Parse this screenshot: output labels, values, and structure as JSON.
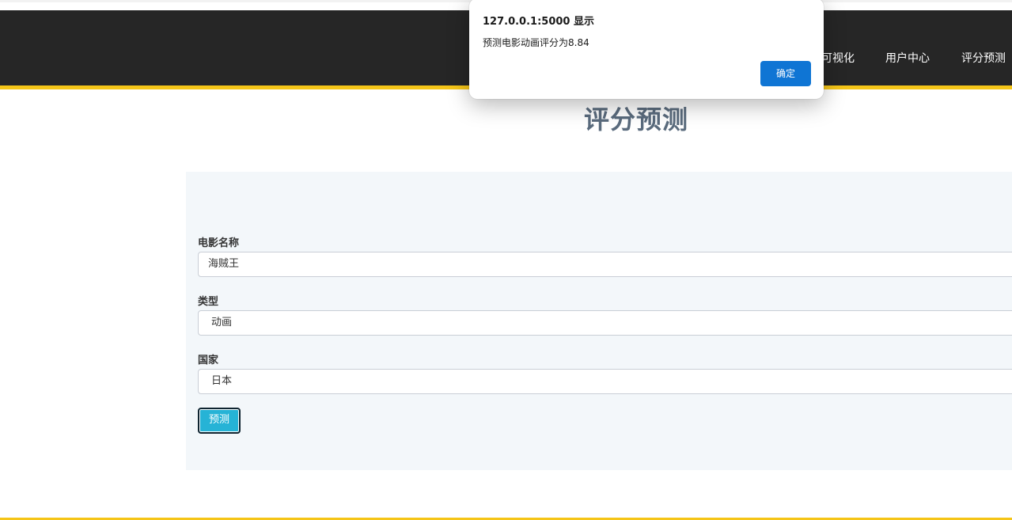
{
  "nav": {
    "links": [
      {
        "label": "可视化"
      },
      {
        "label": "用户中心"
      },
      {
        "label": "评分预测"
      }
    ]
  },
  "page": {
    "title": "评分预测"
  },
  "form": {
    "name_label": "电影名称",
    "name_value": "海贼王",
    "type_label": "类型",
    "type_value": "动画",
    "country_label": "国家",
    "country_value": "日本",
    "submit_label": "预测"
  },
  "alert": {
    "title": "127.0.0.1:5000 显示",
    "message": "预测电影动画评分为8.84",
    "ok_label": "确定"
  },
  "colors": {
    "navbar_bg": "#262626",
    "accent_yellow": "#f5c518",
    "panel_bg": "#f3f7fa",
    "button_bg": "#26b3d6",
    "alert_button": "#0f75d4",
    "title_color": "#5a6b7d"
  }
}
